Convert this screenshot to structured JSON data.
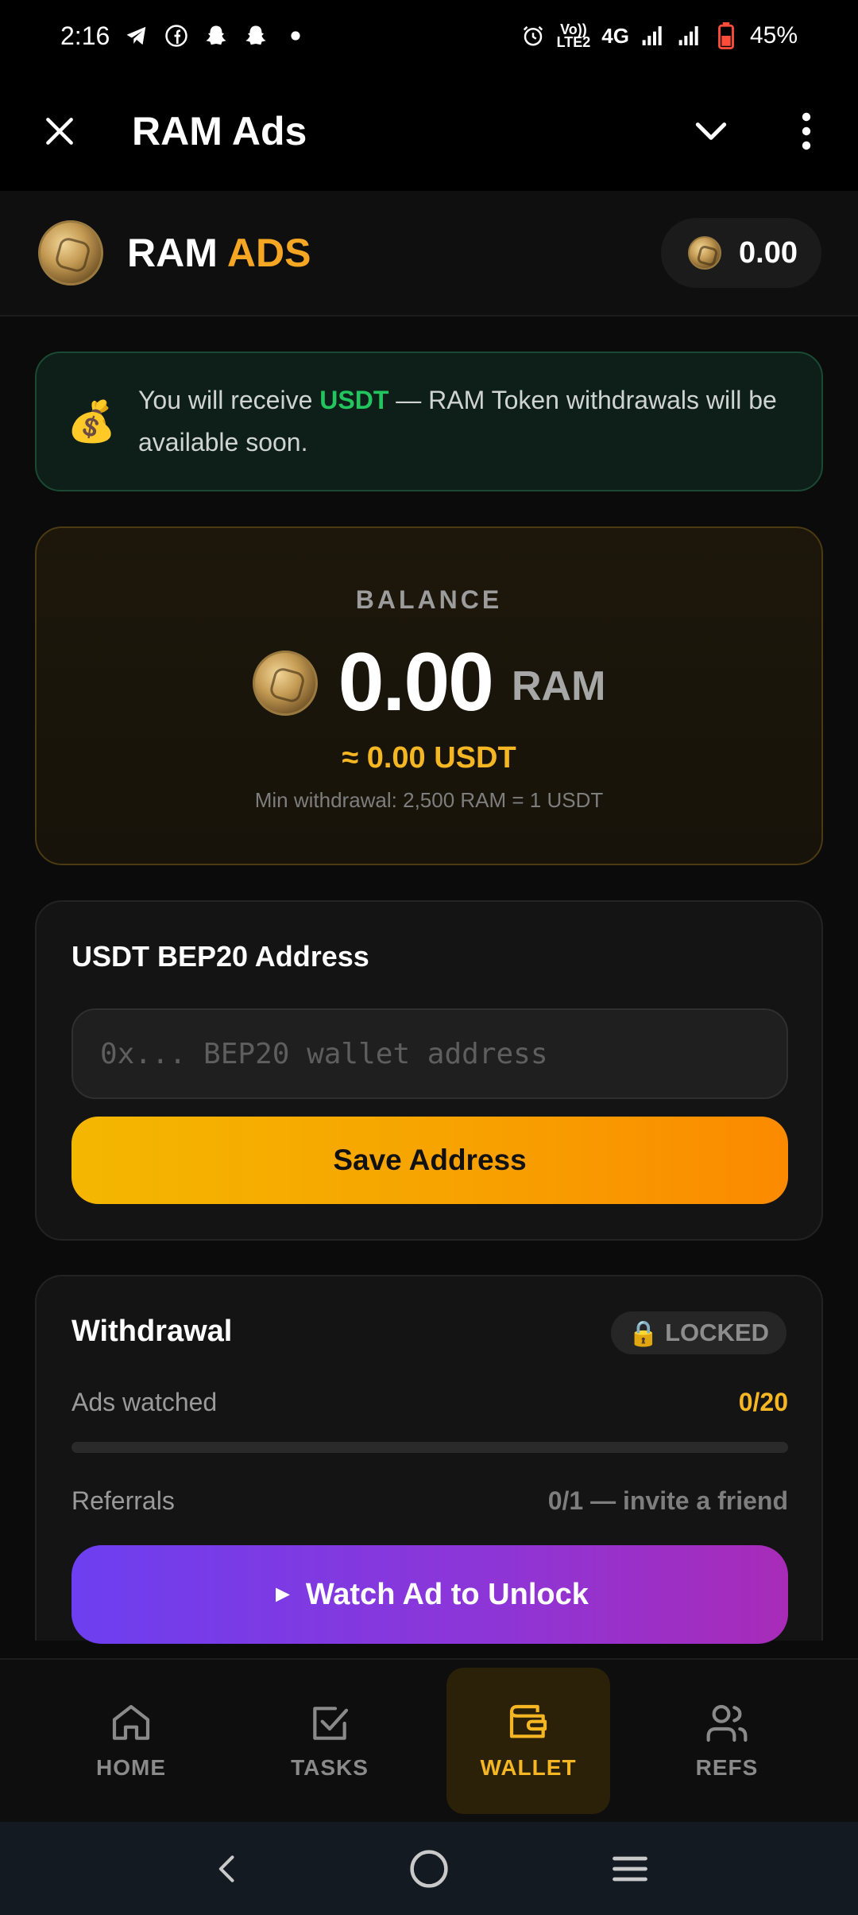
{
  "status_bar": {
    "time": "2:16",
    "network_label_top": "Vo))",
    "network_label_bottom": "LTE2",
    "network_type": "4G",
    "battery": "45%"
  },
  "title_bar": {
    "title": "RAM Ads"
  },
  "header": {
    "brand_first": "RAM",
    "brand_second": "ADS",
    "balance": "0.00"
  },
  "notice": {
    "icon": "💰",
    "prefix": "You will receive ",
    "highlight": "USDT",
    "suffix": " — RAM Token withdrawals will be available soon."
  },
  "balance_card": {
    "label": "BALANCE",
    "amount": "0.00",
    "unit": "RAM",
    "usdt": "≈ 0.00 USDT",
    "min": "Min withdrawal: 2,500 RAM = 1 USDT"
  },
  "address_card": {
    "title": "USDT BEP20 Address",
    "input_value": "",
    "input_placeholder": "0x... BEP20 wallet address",
    "save_label": "Save Address"
  },
  "withdrawal_card": {
    "title": "Withdrawal",
    "locked_icon": "🔒",
    "locked_label": "LOCKED",
    "ads_label": "Ads watched",
    "ads_value": "0/20",
    "ads_progress": 0,
    "referrals_label": "Referrals",
    "referrals_value": "0/1 — invite a friend",
    "watch_icon": "►",
    "watch_label": "Watch Ad to Unlock"
  },
  "bottom_nav": {
    "items": [
      {
        "label": "HOME",
        "icon": "home-icon"
      },
      {
        "label": "TASKS",
        "icon": "tasks-icon"
      },
      {
        "label": "WALLET",
        "icon": "wallet-icon",
        "active": true
      },
      {
        "label": "REFS",
        "icon": "users-icon"
      }
    ]
  },
  "colors": {
    "accent": "#f5a623",
    "usdt_green": "#22c55e",
    "purple": "#7c3aed"
  }
}
